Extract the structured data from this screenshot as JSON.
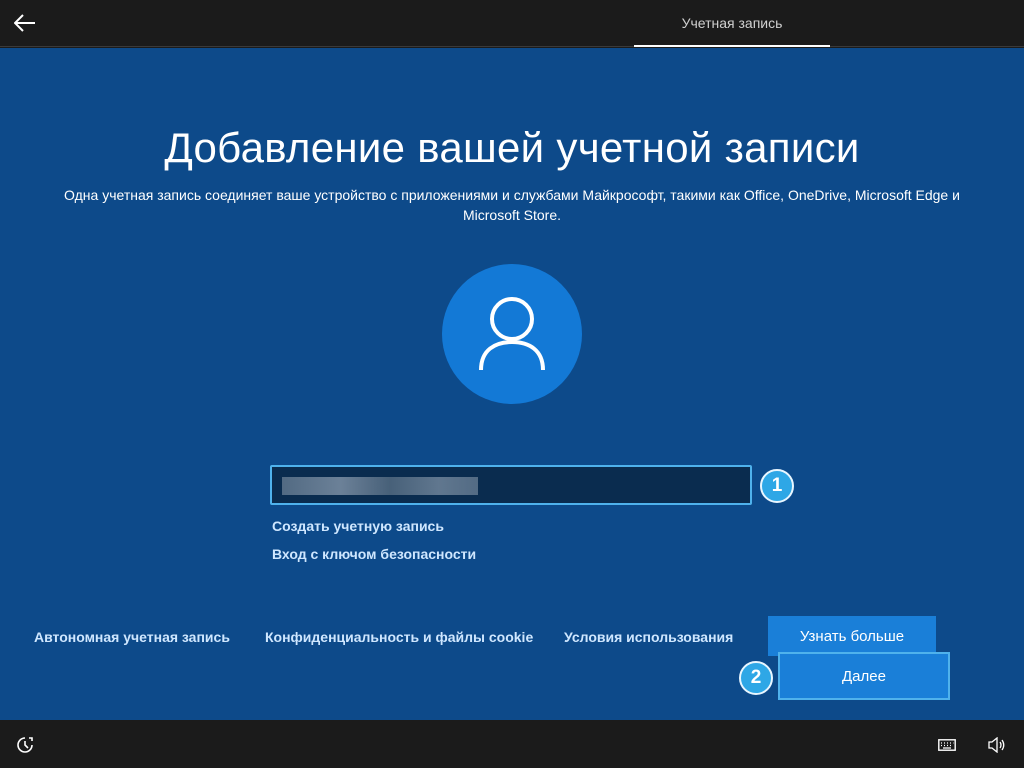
{
  "header": {
    "back_icon": "arrow-left-icon",
    "tab_label": "Учетная запись"
  },
  "main": {
    "title": "Добавление вашей учетной записи",
    "subtitle": "Одна учетная запись соединяет ваше устройство с приложениями и службами Майкрософт, такими как Office, OneDrive, Microsoft Edge и Microsoft Store.",
    "avatar_icon": "user-icon",
    "email_field": {
      "value": "",
      "placeholder": ""
    },
    "links": {
      "create_account": "Создать учетную запись",
      "security_key": "Вход с ключом безопасности"
    },
    "annotations": {
      "step1": "1",
      "step2": "2"
    }
  },
  "footer": {
    "offline_account": "Автономная учетная запись",
    "privacy": "Конфиденциальность и файлы cookie",
    "terms": "Условия использования",
    "learn_more": "Узнать больше",
    "next": "Далее"
  },
  "taskbar": {
    "ease_icon": "ease-of-access-icon",
    "keyboard_icon": "keyboard-icon",
    "volume_icon": "volume-icon"
  },
  "colors": {
    "background": "#0d4a8a",
    "accent": "#1a7fd8",
    "avatar_bg": "#1379d6",
    "focus_border": "#4fb2ec",
    "badge": "#2ea7e6",
    "link": "#cfe7ff"
  }
}
